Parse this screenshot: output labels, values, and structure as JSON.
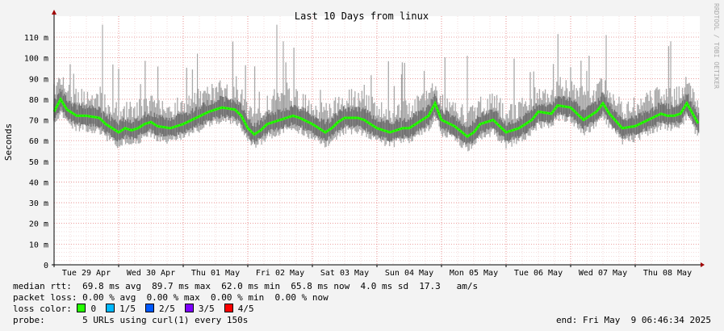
{
  "chart_data": {
    "type": "line",
    "title": "Last 10 Days from linux",
    "ylabel": "Seconds",
    "watermark": "RRDTOOL / TOBI OETIKER",
    "ylim": [
      0,
      0.115
    ],
    "y_ticks": [
      {
        "value": 0,
        "label": "0"
      },
      {
        "value": 0.01,
        "label": "10 m"
      },
      {
        "value": 0.02,
        "label": "20 m"
      },
      {
        "value": 0.03,
        "label": "30 m"
      },
      {
        "value": 0.04,
        "label": "40 m"
      },
      {
        "value": 0.05,
        "label": "50 m"
      },
      {
        "value": 0.06,
        "label": "60 m"
      },
      {
        "value": 0.07,
        "label": "70 m"
      },
      {
        "value": 0.08,
        "label": "80 m"
      },
      {
        "value": 0.09,
        "label": "90 m"
      },
      {
        "value": 0.1,
        "label": "100 m"
      },
      {
        "value": 0.11,
        "label": "110 m"
      }
    ],
    "x_range_days": [
      0,
      10
    ],
    "x_ticks": [
      "Tue 29 Apr",
      "Wed 30 Apr",
      "Thu 01 May",
      "Fri 02 May",
      "Sat 03 May",
      "Sun 04 May",
      "Mon 05 May",
      "Tue 06 May",
      "Wed 07 May",
      "Thu 08 May"
    ],
    "grid": true,
    "median_series": {
      "name": "median rtt",
      "x_days": [
        0.0,
        0.1,
        0.2,
        0.35,
        0.5,
        0.7,
        0.8,
        0.9,
        1.0,
        1.1,
        1.2,
        1.3,
        1.4,
        1.5,
        1.6,
        1.8,
        2.0,
        2.2,
        2.4,
        2.6,
        2.8,
        2.9,
        3.0,
        3.1,
        3.2,
        3.3,
        3.5,
        3.7,
        3.8,
        4.0,
        4.2,
        4.3,
        4.4,
        4.5,
        4.7,
        4.8,
        5.0,
        5.2,
        5.4,
        5.5,
        5.6,
        5.8,
        5.9,
        6.0,
        6.2,
        6.4,
        6.5,
        6.6,
        6.8,
        7.0,
        7.2,
        7.4,
        7.5,
        7.7,
        7.8,
        8.0,
        8.2,
        8.4,
        8.5,
        8.6,
        8.8,
        9.0,
        9.2,
        9.4,
        9.5,
        9.6,
        9.7,
        9.8,
        10.0
      ],
      "values": [
        0.074,
        0.08,
        0.075,
        0.072,
        0.072,
        0.071,
        0.068,
        0.066,
        0.064,
        0.066,
        0.065,
        0.066,
        0.068,
        0.069,
        0.067,
        0.066,
        0.068,
        0.071,
        0.074,
        0.076,
        0.075,
        0.072,
        0.066,
        0.063,
        0.065,
        0.068,
        0.07,
        0.072,
        0.071,
        0.068,
        0.064,
        0.066,
        0.069,
        0.071,
        0.071,
        0.07,
        0.066,
        0.064,
        0.066,
        0.066,
        0.068,
        0.072,
        0.078,
        0.07,
        0.067,
        0.062,
        0.064,
        0.068,
        0.07,
        0.064,
        0.066,
        0.07,
        0.074,
        0.073,
        0.077,
        0.076,
        0.07,
        0.074,
        0.078,
        0.073,
        0.066,
        0.067,
        0.07,
        0.073,
        0.072,
        0.072,
        0.073,
        0.078,
        0.067
      ]
    },
    "loss_color_series": {
      "name": "0",
      "color": "#00ff00"
    },
    "spread_color": "#808080"
  },
  "legend": {
    "median_line": "median rtt:  69.8 ms avg  89.7 ms max  62.0 ms min  65.8 ms now  4.0 ms sd  17.3   am/s",
    "packet_line": "packet loss: 0.00 % avg  0.00 % max  0.00 % min  0.00 % now",
    "loss_color_label": "loss color:",
    "loss_colors": [
      {
        "label": "0",
        "color": "#26ff00"
      },
      {
        "label": "1/5",
        "color": "#00b8ff"
      },
      {
        "label": "2/5",
        "color": "#0059ff"
      },
      {
        "label": "3/5",
        "color": "#7e00ff"
      },
      {
        "label": "4/5",
        "color": "#ff0000"
      }
    ],
    "probe_line": "probe:       5 URLs using curl(1) every 150s",
    "end_line": "end: Fri May  9 06:46:34 2025"
  }
}
